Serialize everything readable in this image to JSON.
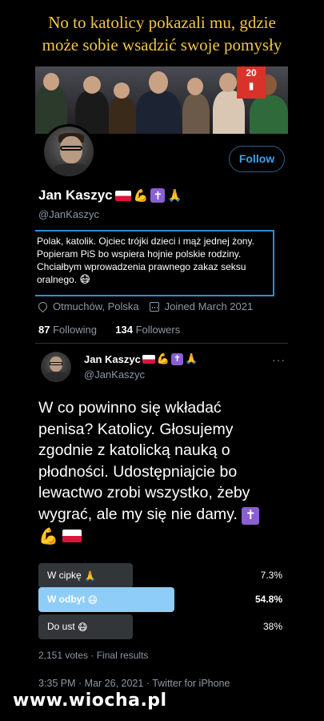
{
  "meme": {
    "title_line1": "No to katolicy pokazali mu, gdzie",
    "title_line2": "może sobie wsadzić swoje pomysły",
    "watermark": "www.wiocha.pl"
  },
  "profile": {
    "follow_label": "Follow",
    "display_name": "Jan Kaszyc",
    "handle": "@JanKaszyc",
    "bio": "Polak, katolik. Ojciec trójki dzieci i mąż jednej żony. Popieram PiS bo wspiera hojnie polskie rodziny. Chciałbym wprowadzenia prawnego zakaz seksu oralnego.",
    "bio_emoji": "😷",
    "location": "Otmuchów, Polska",
    "joined": "Joined March 2021",
    "following_count": "87",
    "following_label": "Following",
    "followers_count": "134",
    "followers_label": "Followers",
    "name_emoji": {
      "flag": "poland-flag",
      "arm": "💪",
      "cross": "✝",
      "hands": "🙏"
    }
  },
  "tweet": {
    "author_name": "Jan Kaszyc",
    "author_handle": "@JanKaszyc",
    "more": "···",
    "text_l1": "W co powinno się wkładać",
    "text_l2": "penisa? Katolicy. Głosujemy",
    "text_l3": "zgodnie z katolicką nauką o",
    "text_l4": "płodności. Udostępniajcie bo",
    "text_l5": "lewactwo zrobi wszystko, żeby",
    "text_l6": "wygrać, ale my się nie damy.",
    "poll": {
      "options": [
        {
          "label": "W cipkę",
          "emoji": "🙏",
          "percent": "7.3%",
          "fraction": 0.073
        },
        {
          "label": "W odbyt",
          "emoji": "😷",
          "percent": "54.8%",
          "fraction": 0.548,
          "winner": true
        },
        {
          "label": "Do ust",
          "emoji": "😷",
          "percent": "38%",
          "fraction": 0.38
        }
      ],
      "votes": "2,151 votes",
      "status": "Final results"
    },
    "time": "3:35 PM · Mar 26, 2021 · Twitter for iPhone"
  },
  "colors": {
    "accent_blue": "#3fa2e8",
    "bio_border": "#2d8ed6",
    "poll_winner": "#8ecdf8",
    "poll_other": "#333639",
    "title_yellow": "#f2c744",
    "muted": "#8b98a5"
  }
}
